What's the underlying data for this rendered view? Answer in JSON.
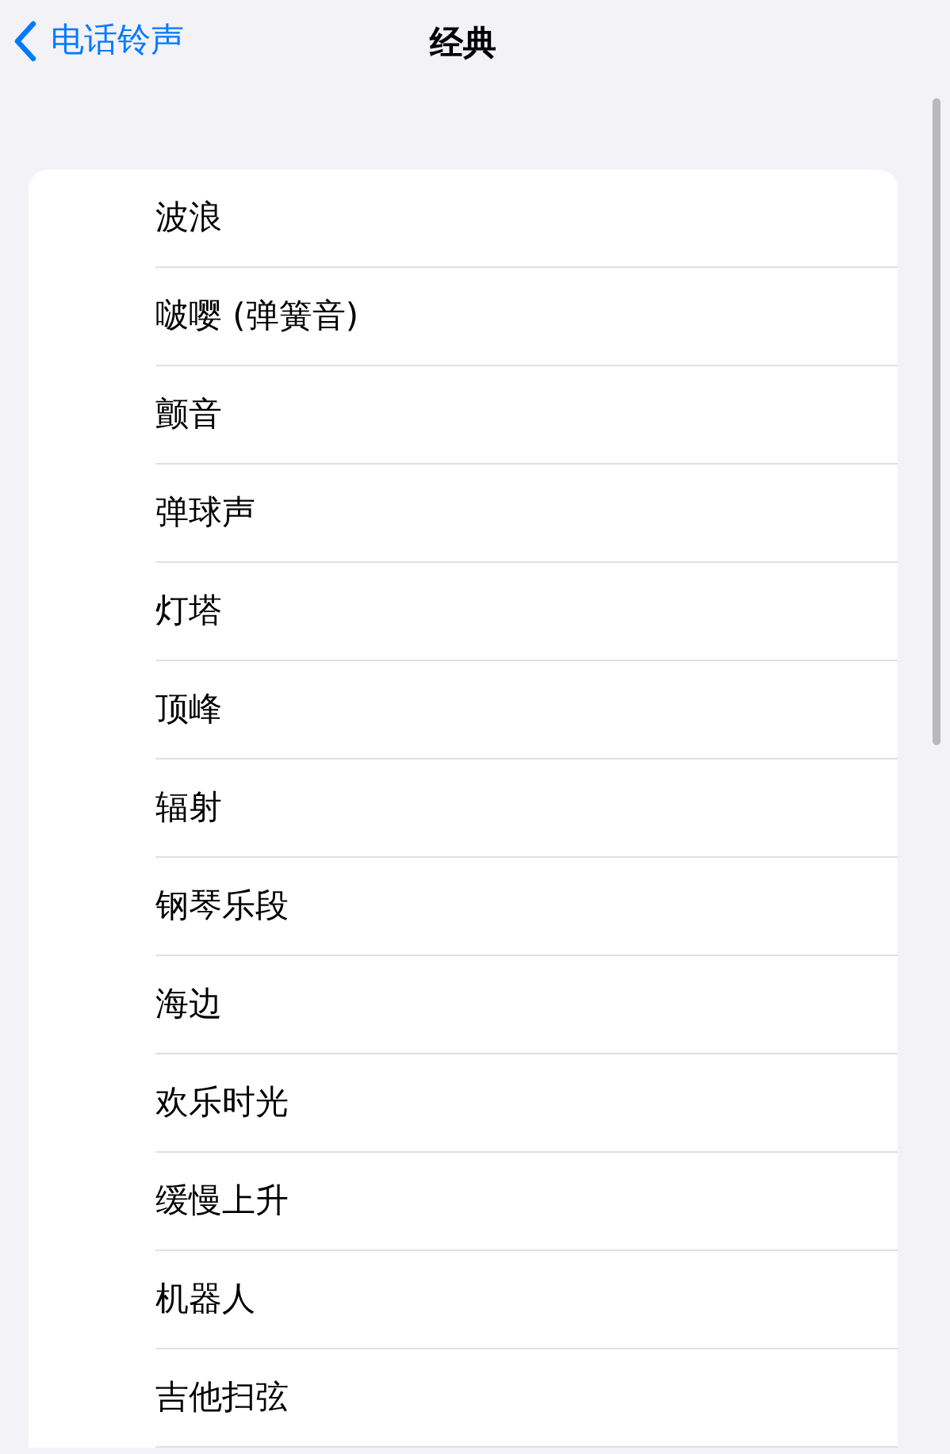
{
  "nav_bar": {
    "back_label": "电话铃声",
    "title": "经典"
  },
  "ringtones": [
    {
      "name": "波浪"
    },
    {
      "name": "啵嘤 (弹簧音)"
    },
    {
      "name": "颤音"
    },
    {
      "name": "弹球声"
    },
    {
      "name": "灯塔"
    },
    {
      "name": "顶峰"
    },
    {
      "name": "辐射"
    },
    {
      "name": "钢琴乐段"
    },
    {
      "name": "海边"
    },
    {
      "name": "欢乐时光"
    },
    {
      "name": "缓慢上升"
    },
    {
      "name": "机器人"
    },
    {
      "name": "吉他扫弦"
    }
  ]
}
